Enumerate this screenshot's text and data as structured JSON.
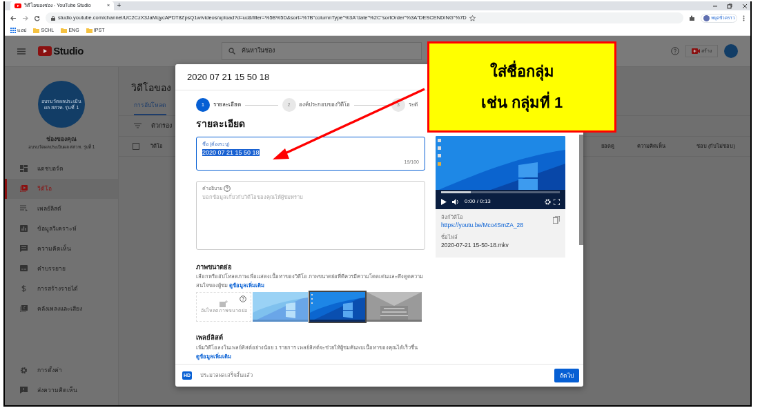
{
  "browser": {
    "tab_title": "วิดีโอของช่อง - YouTube Studio",
    "tab_close": "×",
    "new_tab": "+",
    "url": "studio.youtube.com/channel/UC2CzX3JaMqycAPDT8ZpsQ1w/videos/upload?d=ud&filter=%5B%5D&sort=%7B\"columnType\"%3A\"date\"%2C\"sortOrder\"%3A\"DESCENDING\"%7D",
    "bookmarks": [
      "แอป",
      "SCHL",
      "ENG",
      "IPST"
    ],
    "profile": "หยุดชั่วคราว"
  },
  "header": {
    "logo": "Studio",
    "search_placeholder": "ค้นหาในช่อง",
    "create_label": "สร้าง"
  },
  "sidebar": {
    "avatar_text": "อบรมวัดผลประเมินผล สสวท. รุ่นที่ 1",
    "channel_title": "ช่องของคุณ",
    "channel_name": "อบรมวัดผลประเมินผล สสวท. รุ่นที่ 1",
    "items": [
      {
        "label": "แดชบอร์ด",
        "selected": false
      },
      {
        "label": "วิดีโอ",
        "selected": true
      },
      {
        "label": "เพลย์ลิสต์",
        "selected": false
      },
      {
        "label": "ข้อมูลวิเคราะห์",
        "selected": false
      },
      {
        "label": "ความคิดเห็น",
        "selected": false
      },
      {
        "label": "คำบรรยาย",
        "selected": false
      },
      {
        "label": "การสร้างรายได้",
        "selected": false
      },
      {
        "label": "คลังเพลงและเสียง",
        "selected": false
      }
    ],
    "bottom_items": [
      "การตั้งค่า",
      "ส่งความคิดเห็น"
    ]
  },
  "main": {
    "title": "วิดีโอของ",
    "select_all": {
      "checked": false
    },
    "tabs": [
      {
        "label": "การอัปโหลด",
        "selected": true
      }
    ],
    "filter_placeholder": "ตัวกรอง",
    "columns": [
      "วิดีโอ",
      "ยอดดู",
      "ความคิดเห็น",
      "ชอบ (กับไม่ชอบ)"
    ]
  },
  "dialog": {
    "title": "2020 07 21 15 50 18",
    "steps": [
      {
        "number": "1",
        "label": "รายละเอียด",
        "selected": true
      },
      {
        "number": "2",
        "label": "องค์ประกอบของวิดีโอ",
        "selected": false
      },
      {
        "number": "3",
        "label": "ระดั",
        "selected": false
      }
    ],
    "heading": "รายละเอียด",
    "title_field": {
      "label": "ชื่อ (ต้องระบุ)",
      "value": "2020 07 21 15 50 18",
      "counter": "19/100"
    },
    "description_field": {
      "label": "คำอธิบาย",
      "placeholder": "บอกข้อมูลเกี่ยวกับวิดีโอของคุณให้ผู้ชมทราบ"
    },
    "thumbnails": {
      "heading": "ภาพขนาดย่อ",
      "text": "เลือกหรืออัปโหลดภาพเพื่อแสดงเนื้อหาของวิดีโอ ภาพขนาดย่อที่ดีควรมีความโดดเด่นและดึงดูดความสนใจของผู้ชม",
      "link": "ดูข้อมูลเพิ่มเติม",
      "upload_label": "อัปโหลดภาพขนาดย่อ",
      "items": [
        {
          "kind": "picture",
          "selected": false
        },
        {
          "kind": "picture",
          "selected": true
        },
        {
          "kind": "picture",
          "selected": false
        }
      ]
    },
    "playlist": {
      "heading": "เพลย์ลิสต์",
      "text": "เพิ่มวิดีโอลงในเพลย์ลิสต์อย่างน้อย 1 รายการ เพลย์ลิสต์จะช่วยให้ผู้ชมค้นพบเนื้อหาของคุณได้เร็วขึ้น",
      "link": "ดูข้อมูลเพิ่มเติม"
    },
    "video": {
      "time": "0:00 / 0:13",
      "progress": {
        "level": 0.25
      },
      "link_label": "ลิงก์วิดีโอ",
      "link": "https://youtu.be/Mco4SmZA_28",
      "file_label": "ชื่อไฟล์",
      "file_name": "2020-07-21 15-50-18.mkv"
    },
    "footer": {
      "badge": "HD",
      "status": "ประมวลผลเสร็จสิ้นแล้ว",
      "next_button": "ถัดไป"
    }
  },
  "callout": {
    "lines": [
      "ใส่ชื่อกลุ่ม",
      "เช่น กลุ่มที่ 1"
    ]
  }
}
